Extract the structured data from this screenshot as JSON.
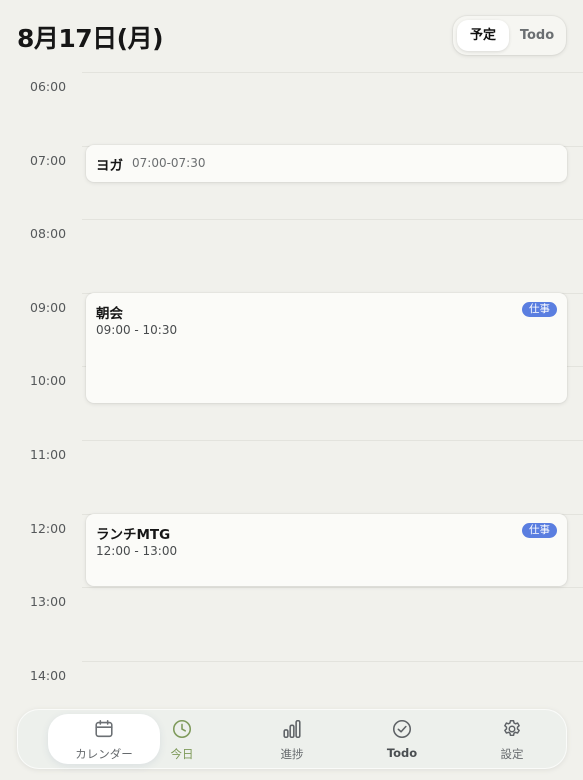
{
  "header": {
    "title": "8月17日(月)",
    "segments": [
      {
        "label": "予定",
        "active": true
      },
      {
        "label": "Todo",
        "active": false
      }
    ]
  },
  "timeline": {
    "hours": [
      "06:00",
      "07:00",
      "08:00",
      "09:00",
      "10:00",
      "11:00",
      "12:00",
      "13:00",
      "14:00"
    ]
  },
  "events": [
    {
      "title": "ヨガ",
      "time": "07:00-07:30",
      "tag": ""
    },
    {
      "title": "朝会",
      "time": "09:00 - 10:30",
      "tag": "仕事"
    },
    {
      "title": "ランチMTG",
      "time": "12:00 - 13:00",
      "tag": "仕事"
    }
  ],
  "tabbar": {
    "items": [
      {
        "label": "カレンダー",
        "icon": "calendar-icon",
        "active": true
      },
      {
        "label": "今日",
        "icon": "clock-icon",
        "active": false
      },
      {
        "label": "進捗",
        "icon": "bar-chart-icon",
        "active": false
      },
      {
        "label": "Todo",
        "icon": "check-circle-icon",
        "active": false
      },
      {
        "label": "設定",
        "icon": "gear-icon",
        "active": false
      }
    ]
  },
  "colors": {
    "background": "#f1f1ec",
    "tag": "#5a7ee0",
    "today_icon": "#7e9a5a"
  }
}
